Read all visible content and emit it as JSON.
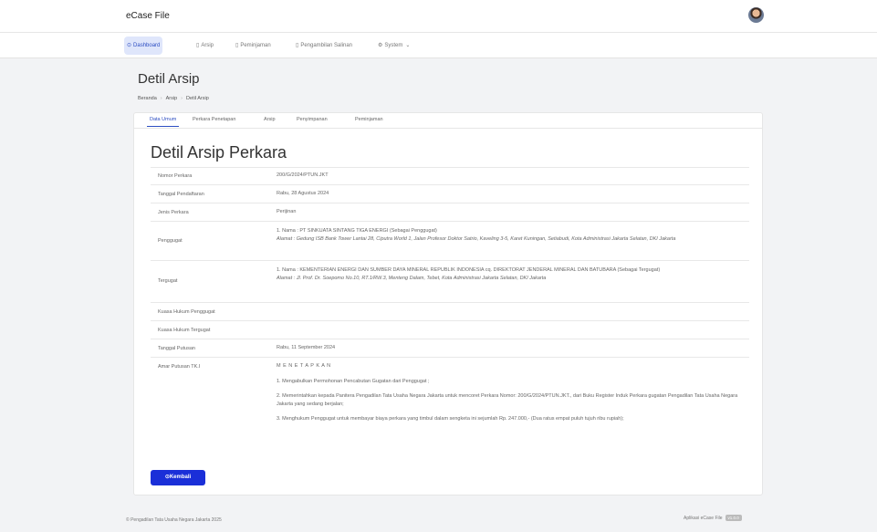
{
  "app": {
    "title": "eCase File"
  },
  "nav": [
    {
      "icon": "⊙",
      "label": "Dashboard",
      "active": true
    },
    {
      "icon": "▯",
      "label": "Arsip",
      "active": false
    },
    {
      "icon": "▯",
      "label": "Peminjaman",
      "active": false
    },
    {
      "icon": "▯",
      "label": "Pengambilan Salinan",
      "active": false
    },
    {
      "icon": "⚙",
      "label": "System",
      "active": false
    }
  ],
  "page": {
    "title": "Detil Arsip"
  },
  "breadcrumb": [
    "Beranda",
    "Arsip",
    "Detil Arsip"
  ],
  "tabs": [
    "Data Umum",
    "Perkara Penetapan",
    "Arsip",
    "Penyimpanan",
    "Peminjaman"
  ],
  "card": {
    "title": "Detil Arsip Perkara"
  },
  "details": {
    "nomor_label": "Nomor Perkara",
    "nomor_value": "200/G/2024/PTUN.JKT",
    "tanggal_label": "Tanggal Pendaftaran",
    "tanggal_value": "Rabu, 28 Agustus 2024",
    "jenis_label": "Jenis Perkara",
    "jenis_value": "Perijinan",
    "penggugat_label": "Penggugat",
    "penggugat_line1": "1. Nama : PT SINKUATA SINTANG TIGA ENERGI (Sebagai Penggugat)",
    "penggugat_line2": "Alamat : Gedung ISB Bank Tower Lantai 28, Ciputra World 1, Jalan Profesor Doktor Satrio, Kaveling 3-5, Karet Kuningan, Setiabudi, Kota Administrasi Jakarta Selatan, DKI Jakarta",
    "tergugat_label": "Tergugat",
    "tergugat_line1": "1. Nama : KEMENTERIAN ENERGI DAN SUMBER DAYA MINERAL REPUBLIK INDONESIA cq. DIREKTORAT JENDERAL MINERAL DAN BATUBARA (Sebagai Tergugat)",
    "tergugat_line2": "Alamat : Jl. Prof. Dr. Soepomo No.10, RT.1/RW.3, Menteng Dalam, Tebet, Kota Administrasi Jakarta Selatan, DKI Jakarta",
    "kuasa_penggugat_label": "Kuasa Hukum Penggugat",
    "kuasa_tergugat_label": "Kuasa Hukum Tergugat",
    "tgl_putusan_label": "Tanggal Putusan",
    "tgl_putusan_value": "Rabu, 11 September 2024",
    "amar_label": "Amar Putusan TK.I",
    "amar_header": "M E N E T A P K A N",
    "amar_1": "1.   Mengabulkan Permohonan Pencabutan Gugatan dari Penggugat ;",
    "amar_2": "2.   Memerintahkan kepada Panitera Pengadilan Tata Usaha Negara Jakarta untuk mencoret Perkara Nomor: 200/G/2024/PTUN.JKT., dari Buku Register Induk Perkara gugatan Pengadilan Tata Usaha Negara Jakarta yang sedang berjalan;",
    "amar_3": "3.   Menghukum Penggugat untuk membayar biaya perkara yang timbul dalam sengketa ini sejumlah Rp. 247.000,- (Dua ratus empat puluh tujuh ribu rupiah);"
  },
  "actions": {
    "back_label": "⊙Kembali"
  },
  "footer": {
    "left": "© Pengadilan Tata Usaha Negara Jakarta 2025",
    "right": "Aplikasi eCase File",
    "version": "v1.0.0"
  },
  "colors": {
    "accent": "#2d4ec2",
    "button": "#1a2fd8"
  }
}
